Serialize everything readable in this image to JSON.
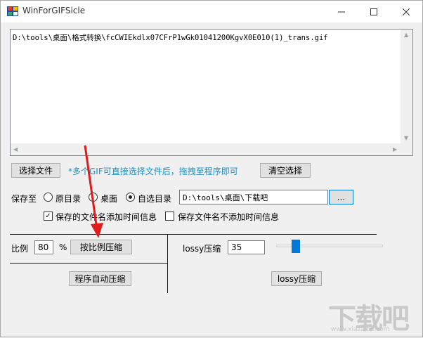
{
  "window": {
    "title": "WinForGIFSicle"
  },
  "file_list": {
    "items": [
      "D:\\tools\\桌面\\格式转换\\fcCWIEkdlx07CFrP1wGk01041200KgvX0E010(1)_trans.gif"
    ]
  },
  "toolbar": {
    "select_file_label": "选择文件",
    "hint": "*多个GIF可直接选择文件后，拖拽至程序即可",
    "clear_label": "清空选择"
  },
  "save": {
    "label": "保存至",
    "options": [
      "原目录",
      "桌面",
      "自选目录"
    ],
    "selected": "自选目录",
    "path": "D:\\tools\\桌面\\下载吧",
    "browse_label": "...",
    "timestamp_on_label": "保存的文件名添加时间信息",
    "timestamp_on_checked": true,
    "timestamp_off_label": "保存文件名不添加时间信息",
    "timestamp_off_checked": false
  },
  "ratio": {
    "label": "比例",
    "value": "80",
    "unit": "%",
    "compress_label": "按比例压缩",
    "auto_label": "程序自动压缩"
  },
  "lossy": {
    "label": "lossy压缩",
    "value": "35",
    "slider_level": 35,
    "slider_min": 0,
    "slider_max": 200,
    "compress_label": "lossy压缩"
  },
  "watermark": {
    "text": "下载吧",
    "sub": "www.xiazaiba.com"
  },
  "colors": {
    "hint": "#1e8fbe",
    "slider_thumb": "#0078d7",
    "annotation_arrow": "#e21b1b"
  }
}
